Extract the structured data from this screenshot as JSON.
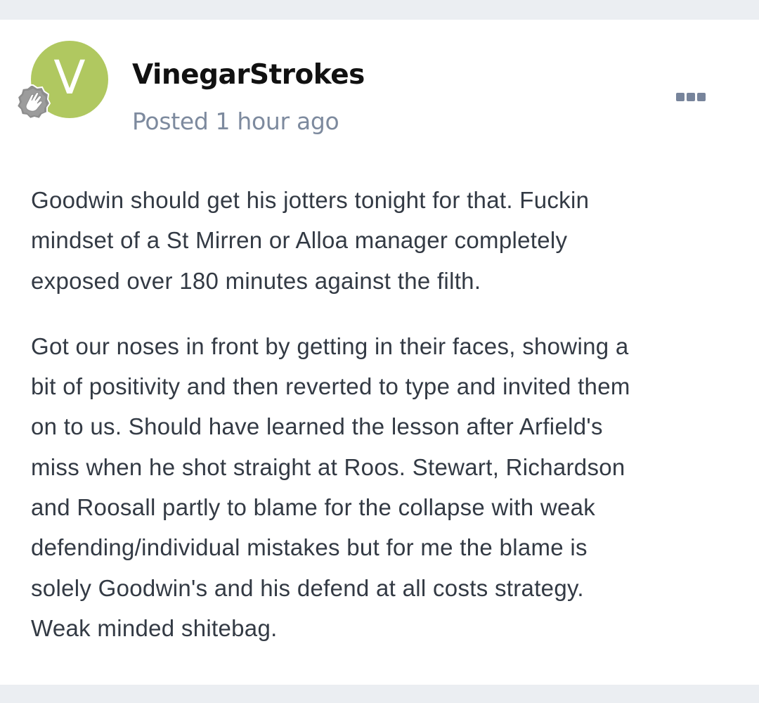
{
  "post": {
    "author": {
      "username": "VinegarStrokes",
      "avatar_letter": "V",
      "avatar_color": "#b0c860",
      "rank_badge_icon": "waving-hand-badge-icon"
    },
    "meta": {
      "posted_label": "Posted",
      "time_ago": "1 hour ago"
    },
    "actions": {
      "more_icon": "ellipsis-icon"
    },
    "paragraphs": [
      {
        "lines": [
          "Goodwin should get his jotters tonight for that. Fuckin",
          "mindset of a St Mirren or Alloa manager completely",
          "exposed over 180 minutes against the filth."
        ]
      },
      {
        "lines": [
          "Got our noses in front by getting in their faces, showing a",
          "bit of positivity and then reverted to type and invited them",
          "on to us. Should have learned the lesson after Arfield's",
          "miss when he shot straight at Roos. Stewart, Richardson",
          "and Roosall partly to blame for the collapse with weak",
          "defending/individual mistakes but for me the blame is",
          "solely Goodwin's and his defend at all costs strategy.",
          "Weak minded shitebag."
        ]
      }
    ]
  }
}
